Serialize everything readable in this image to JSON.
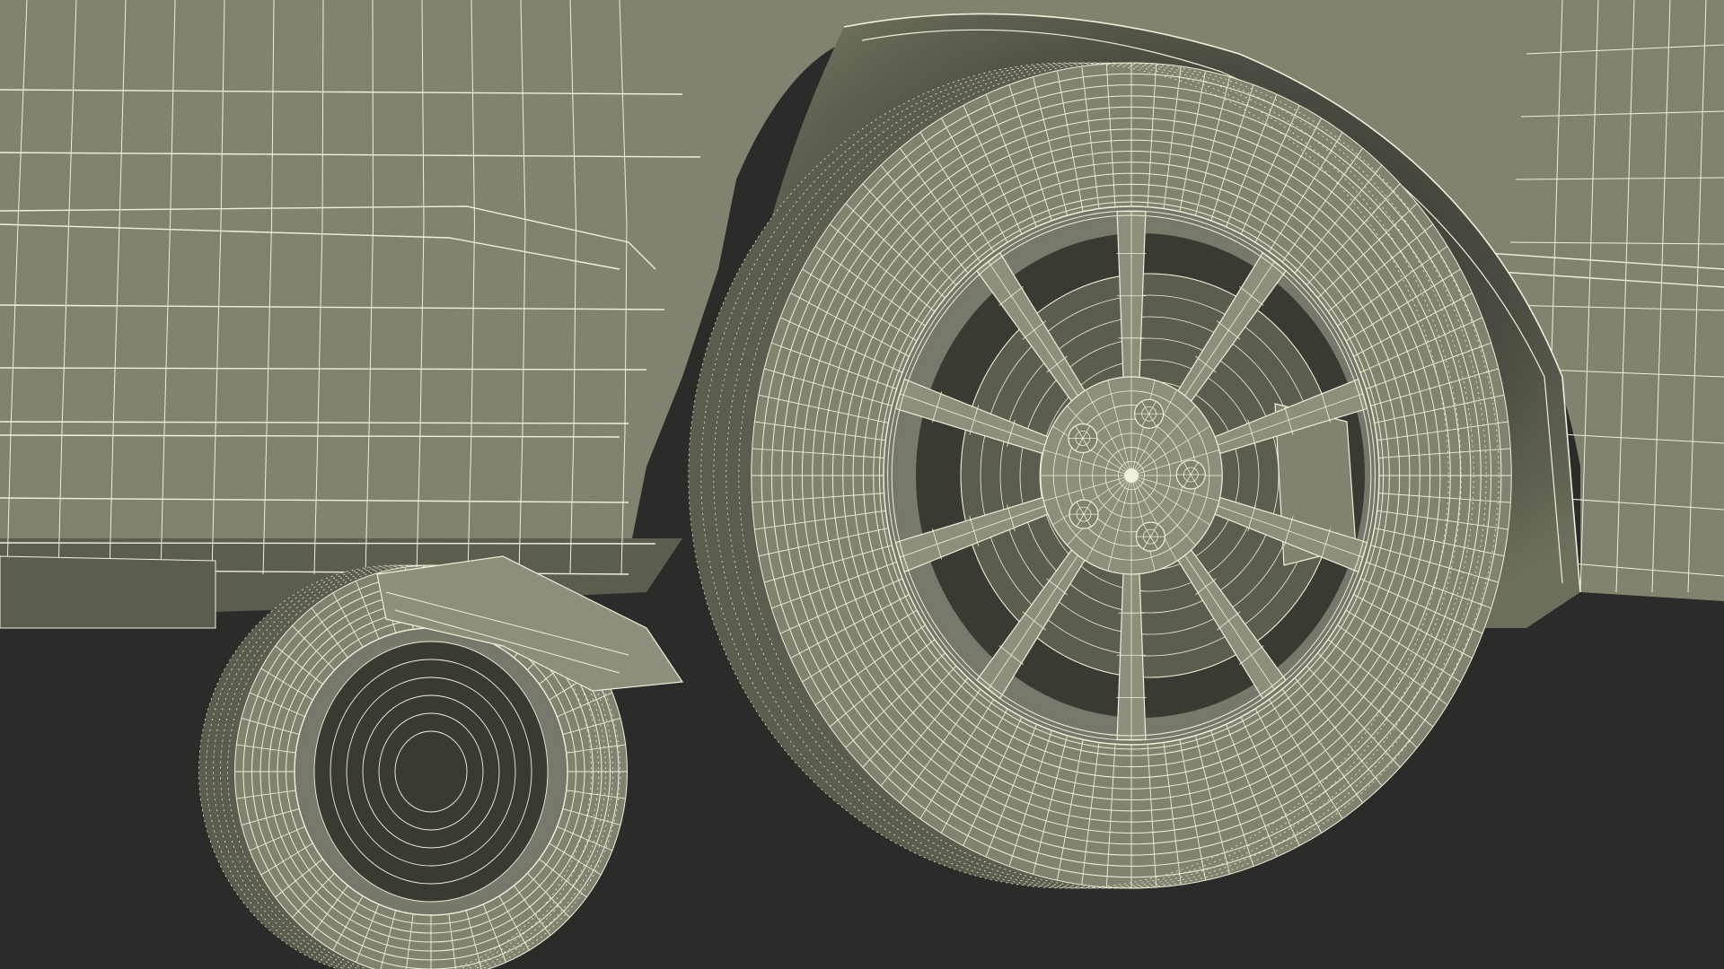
{
  "scene": {
    "subject": "car-rear-wheel-wireframe",
    "render_mode": "wireframe-on-shaded",
    "colors": {
      "background": "#2b2b2a",
      "surface": "#82826f",
      "surface_light": "#8e8e7a",
      "surface_shadow": "#5c5c4f",
      "deep_shadow": "#3a3a33",
      "wire": "#f2f0dc"
    }
  }
}
